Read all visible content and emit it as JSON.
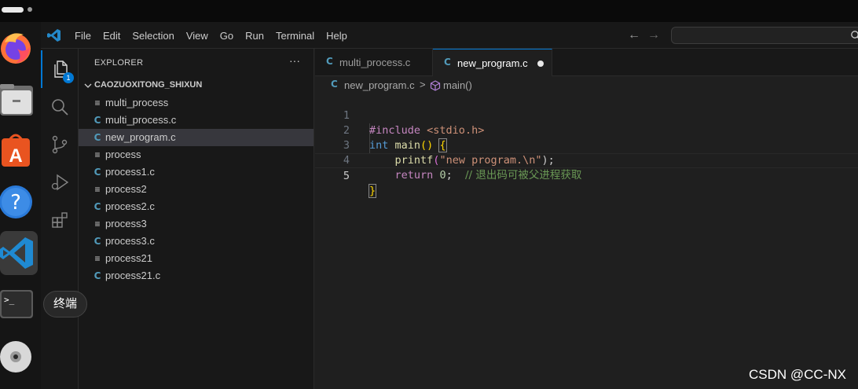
{
  "titlebar": {
    "menu": [
      "File",
      "Edit",
      "Selection",
      "View",
      "Go",
      "Run",
      "Terminal",
      "Help"
    ],
    "search_placeholder": ""
  },
  "activity_bar": {
    "explorer_badge": "1"
  },
  "explorer": {
    "title": "EXPLORER",
    "more": "···",
    "folder": "CAOZUOXITONG_SHIXUN",
    "files": [
      {
        "name": "multi_process",
        "kind": "plain"
      },
      {
        "name": "multi_process.c",
        "kind": "c"
      },
      {
        "name": "new_program.c",
        "kind": "c",
        "selected": true
      },
      {
        "name": "process",
        "kind": "plain"
      },
      {
        "name": "process1.c",
        "kind": "c"
      },
      {
        "name": "process2",
        "kind": "plain"
      },
      {
        "name": "process2.c",
        "kind": "c"
      },
      {
        "name": "process3",
        "kind": "plain"
      },
      {
        "name": "process3.c",
        "kind": "c"
      },
      {
        "name": "process21",
        "kind": "plain"
      },
      {
        "name": "process21.c",
        "kind": "c"
      }
    ]
  },
  "tabs": [
    {
      "label": "multi_process.c",
      "active": false
    },
    {
      "label": "new_program.c",
      "active": true,
      "modified": true
    }
  ],
  "breadcrumb": {
    "file": "new_program.c",
    "separator": ">",
    "symbol": "main()"
  },
  "editor": {
    "line_numbers": [
      "1",
      "2",
      "3",
      "4",
      "5"
    ],
    "current_line": 5,
    "lines": {
      "l1_include": "#include",
      "l1_header": "<stdio.h>",
      "l2_type": "int",
      "l2_fn": "main",
      "l2_parens": "()",
      "l2_brace": "{",
      "l3_fn": "printf",
      "l3_open": "(",
      "l3_str": "\"new program.\\n\"",
      "l3_close": ");",
      "l4_return": "return",
      "l4_num": "0",
      "l4_semi": ";",
      "l4_comment": "// 退出码可被父进程获取",
      "l5_brace": "}"
    }
  },
  "dock": {
    "tooltip": "终端",
    "icons": [
      "firefox-icon",
      "files-icon",
      "app-center-icon",
      "help-icon",
      "vscode-icon",
      "terminal-icon",
      "disc-icon"
    ]
  },
  "watermark": "CSDN @CC-NX",
  "colors": {
    "accent": "#0078d4",
    "c_file": "#519aba",
    "keyword": "#c586c0",
    "type": "#569cd6",
    "function": "#dcdcaa",
    "string": "#ce9178",
    "number": "#b5cea8",
    "comment": "#6a9955"
  }
}
